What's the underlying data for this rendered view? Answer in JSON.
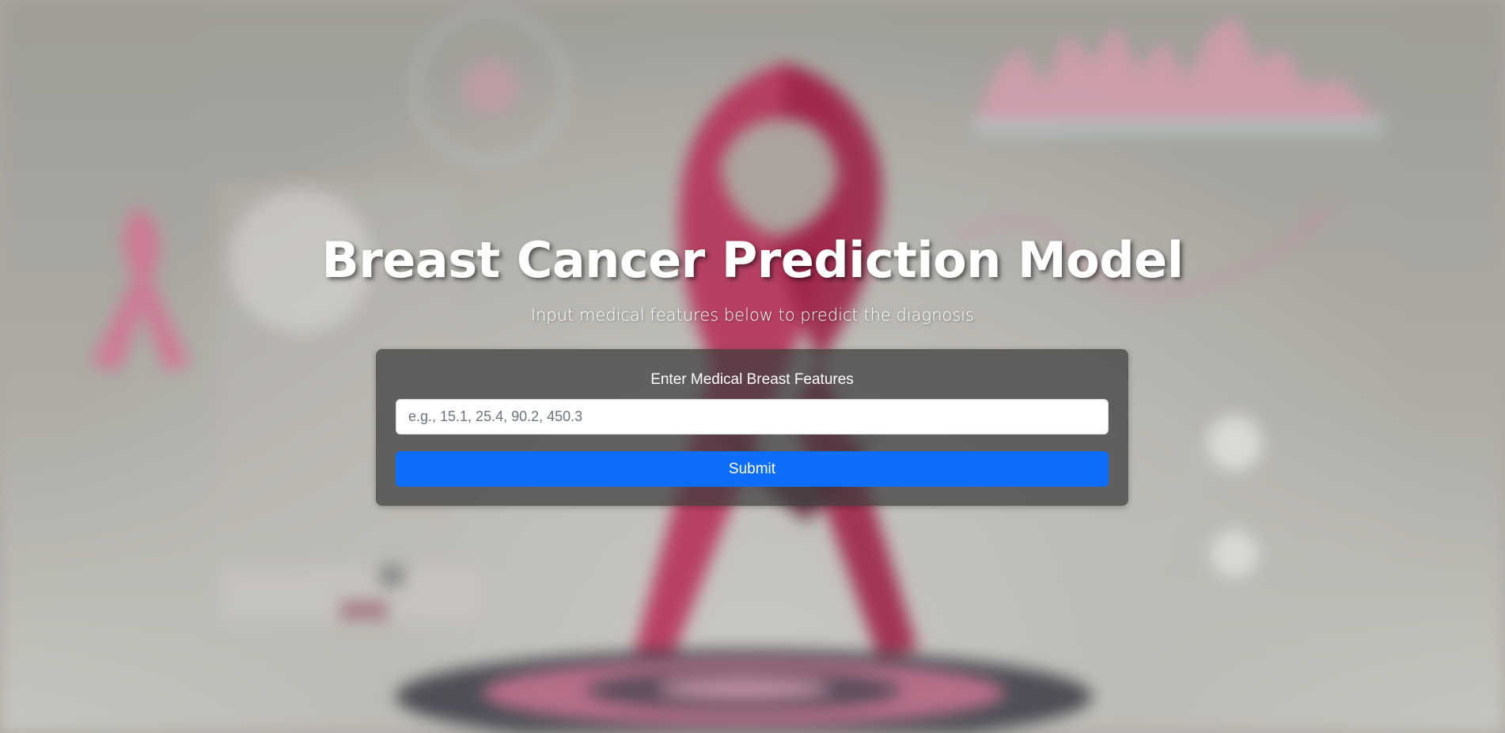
{
  "header": {
    "title": "Breast Cancer Prediction Model",
    "subtitle": "Input medical features below to predict the diagnosis"
  },
  "form": {
    "label": "Enter Medical Breast Features",
    "input_placeholder": "e.g., 15.1, 25.4, 90.2, 450.3",
    "input_value": "",
    "submit_label": "Submit"
  },
  "background": {
    "image_name": "pink-ribbon-awareness-background",
    "accent_color": "#c2365f",
    "button_color": "#0d6efd"
  }
}
